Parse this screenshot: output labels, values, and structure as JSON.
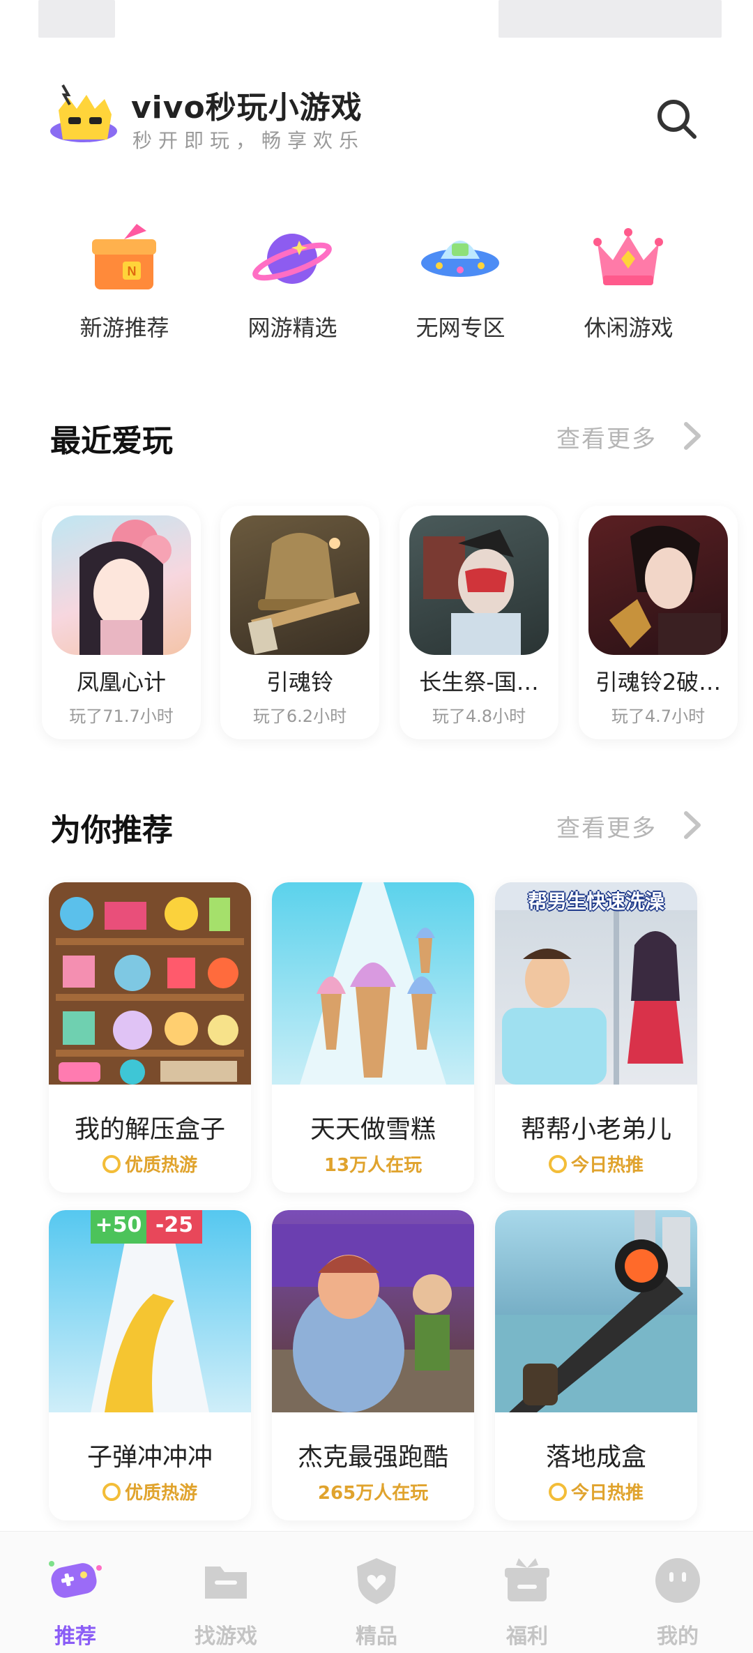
{
  "header": {
    "brand_title": "vivo秒玩小游戏",
    "brand_subtitle": "秒开即玩，畅享欢乐",
    "search_icon": "search-icon"
  },
  "categories": [
    {
      "label": "新游推荐",
      "icon": "gift-box-icon"
    },
    {
      "label": "网游精选",
      "icon": "planet-icon"
    },
    {
      "label": "无网专区",
      "icon": "ufo-icon"
    },
    {
      "label": "休闲游戏",
      "icon": "crown-icon"
    }
  ],
  "recent": {
    "title": "最近爱玩",
    "more": "查看更多",
    "items": [
      {
        "name": "凤凰心计",
        "time": "玩了71.7小时"
      },
      {
        "name": "引魂铃",
        "time": "玩了6.2小时"
      },
      {
        "name": "长生祭-国…",
        "time": "玩了4.8小时"
      },
      {
        "name": "引魂铃2破…",
        "time": "玩了4.7小时"
      }
    ]
  },
  "recommend": {
    "title": "为你推荐",
    "more": "查看更多",
    "items": [
      {
        "name": "我的解压盒子",
        "tag": "优质热游",
        "coin": true
      },
      {
        "name": "天天做雪糕",
        "tag": "13万人在玩",
        "coin": false
      },
      {
        "name": "帮帮小老弟儿",
        "tag": "今日热推",
        "coin": true,
        "banner": "帮男生快速洗澡"
      },
      {
        "name": "子弹冲冲冲",
        "tag": "优质热游",
        "coin": true,
        "banner_left": "+50",
        "banner_right": "-25"
      },
      {
        "name": "杰克最强跑酷",
        "tag": "265万人在玩",
        "coin": false
      },
      {
        "name": "落地成盒",
        "tag": "今日热推",
        "coin": true
      }
    ]
  },
  "nav": {
    "items": [
      {
        "label": "推荐",
        "icon": "gamepad-icon",
        "active": true
      },
      {
        "label": "找游戏",
        "icon": "folder-icon",
        "active": false
      },
      {
        "label": "精品",
        "icon": "shield-heart-icon",
        "active": false
      },
      {
        "label": "福利",
        "icon": "gift-icon",
        "active": false
      },
      {
        "label": "我的",
        "icon": "smile-icon",
        "active": false
      }
    ]
  },
  "colors": {
    "accent": "#8a5cf6",
    "tag_gold": "#e0a32d",
    "muted": "#b5b5b5"
  }
}
